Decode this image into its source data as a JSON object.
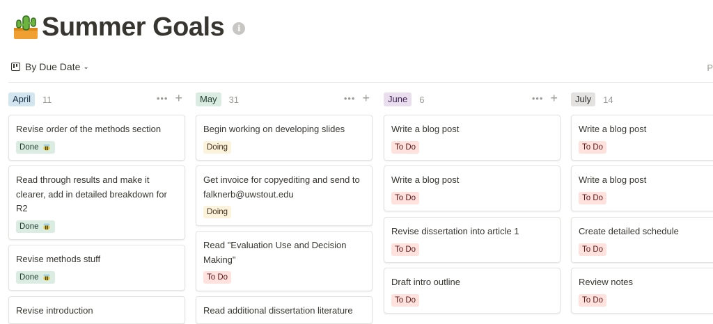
{
  "page": {
    "title": "Summer Goals",
    "info_glyph": "i",
    "right_cut_text": "P"
  },
  "view": {
    "label": "By Due Date",
    "icon": "board-icon"
  },
  "colors": {
    "done": "#dbede3",
    "doing": "#fbf3db",
    "todo": "#ffe2dd"
  },
  "columns": [
    {
      "name": "April",
      "count": "11",
      "color": "#d3e5ef",
      "cards": [
        {
          "title": "Revise order of the methods section",
          "status": "Done"
        },
        {
          "title": "Read through results and make it clearer, add in detailed breakdown for R2",
          "status": "Done"
        },
        {
          "title": "Revise methods stuff",
          "status": "Done"
        },
        {
          "title": "Revise introduction",
          "status": ""
        }
      ]
    },
    {
      "name": "May",
      "count": "31",
      "color": "#dbede3",
      "cards": [
        {
          "title": "Begin working on developing slides",
          "status": "Doing"
        },
        {
          "title": "Get invoice for copyediting and send to falknerb@uwstout.edu",
          "status": "Doing"
        },
        {
          "title": "Read \"Evaluation Use and Decision Making\"",
          "status": "To Do"
        },
        {
          "title": "Read additional dissertation literature",
          "status": ""
        }
      ]
    },
    {
      "name": "June",
      "count": "6",
      "color": "#e8deee",
      "cards": [
        {
          "title": "Write a blog post",
          "status": "To Do"
        },
        {
          "title": "Write a blog post",
          "status": "To Do"
        },
        {
          "title": "Revise dissertation into article 1",
          "status": "To Do"
        },
        {
          "title": "Draft intro outline",
          "status": "To Do"
        }
      ]
    },
    {
      "name": "July",
      "count": "14",
      "color": "#e3e2e0",
      "cards": [
        {
          "title": "Write a blog post",
          "status": "To Do"
        },
        {
          "title": "Write a blog post",
          "status": "To Do"
        },
        {
          "title": "Create detailed schedule",
          "status": "To Do"
        },
        {
          "title": "Review notes",
          "status": "To Do"
        }
      ]
    }
  ]
}
